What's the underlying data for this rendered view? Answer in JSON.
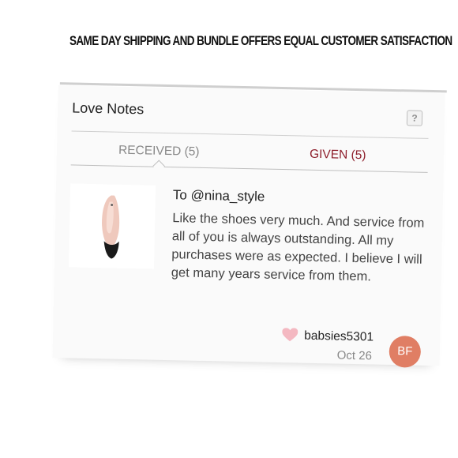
{
  "headline": "SAME DAY SHIPPING AND BUNDLE OFFERS EQUAL CUSTOMER SATISFACTION",
  "card": {
    "title": "Love Notes",
    "help_label": "?",
    "tabs": [
      {
        "label": "RECEIVED (5)",
        "active": true
      },
      {
        "label": "GIVEN (5)",
        "active": false
      }
    ],
    "note": {
      "recipient": "To @nina_style",
      "message": "Like the shoes very much. And service from all of you is always outstanding. All my purchases were as expected. I believe I will get many years service from them.",
      "username": "babsies5301",
      "date": "Oct 26",
      "avatar_initials": "BF"
    }
  },
  "colors": {
    "given_tab": "#8e1f2c",
    "avatar_bg": "#e07e64",
    "heart": "#f4b8c1"
  },
  "icons": [
    "help-icon",
    "heart-icon",
    "shoe-image"
  ]
}
